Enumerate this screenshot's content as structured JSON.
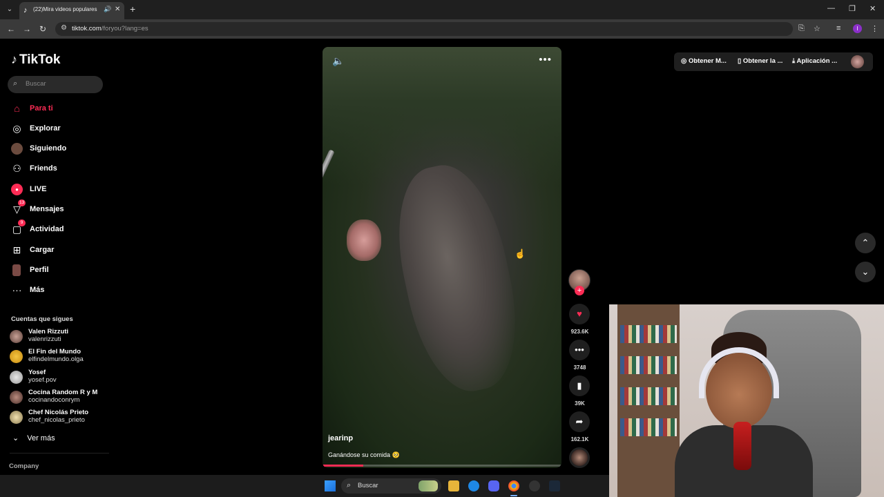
{
  "browser": {
    "tab_title": "(22)Mira videos populares",
    "url_host": "tiktok.com",
    "url_path": "/foryou?lang=es"
  },
  "sidebar": {
    "logo": "TikTok",
    "search_placeholder": "Buscar",
    "nav": [
      {
        "label": "Para ti",
        "icon": "home-icon"
      },
      {
        "label": "Explorar",
        "icon": "compass-icon"
      },
      {
        "label": "Siguiendo",
        "icon": "avatar-icon"
      },
      {
        "label": "Friends",
        "icon": "friends-icon"
      },
      {
        "label": "LIVE",
        "icon": "live-icon"
      },
      {
        "label": "Mensajes",
        "icon": "message-icon",
        "badge": "13"
      },
      {
        "label": "Actividad",
        "icon": "activity-icon",
        "badge": "9"
      },
      {
        "label": "Cargar",
        "icon": "upload-icon"
      },
      {
        "label": "Perfil",
        "icon": "profile-icon"
      },
      {
        "label": "Más",
        "icon": "more-icon"
      }
    ],
    "following_title": "Cuentas que sigues",
    "following": [
      {
        "name": "Valen Rizzuti",
        "handle": "valenrizzuti"
      },
      {
        "name": "El Fin del Mundo",
        "handle": "elfindelmundo.olga"
      },
      {
        "name": "Yosef",
        "handle": "yosef.pov"
      },
      {
        "name": "Cocina Random R y M",
        "handle": "cocinandoconrym"
      },
      {
        "name": "Chef Nicolás Prieto",
        "handle": "chef_nicolas_prieto"
      }
    ],
    "see_more": "Ver más",
    "company": "Company"
  },
  "video": {
    "author": "jearinp",
    "caption": "Ganándose su comida 🥺",
    "progress": 0.17
  },
  "actions": {
    "likes": "923.6K",
    "comments": "3748",
    "saves": "39K",
    "shares": "162.1K"
  },
  "top_bar": {
    "item1": "Obtener M...",
    "item2": "Obtener la ...",
    "item3": "Aplicación ..."
  },
  "taskbar": {
    "search": "Buscar"
  },
  "colors": {
    "accent": "#fe2c55",
    "background": "#000000",
    "chrome": "#3a3a3a"
  }
}
